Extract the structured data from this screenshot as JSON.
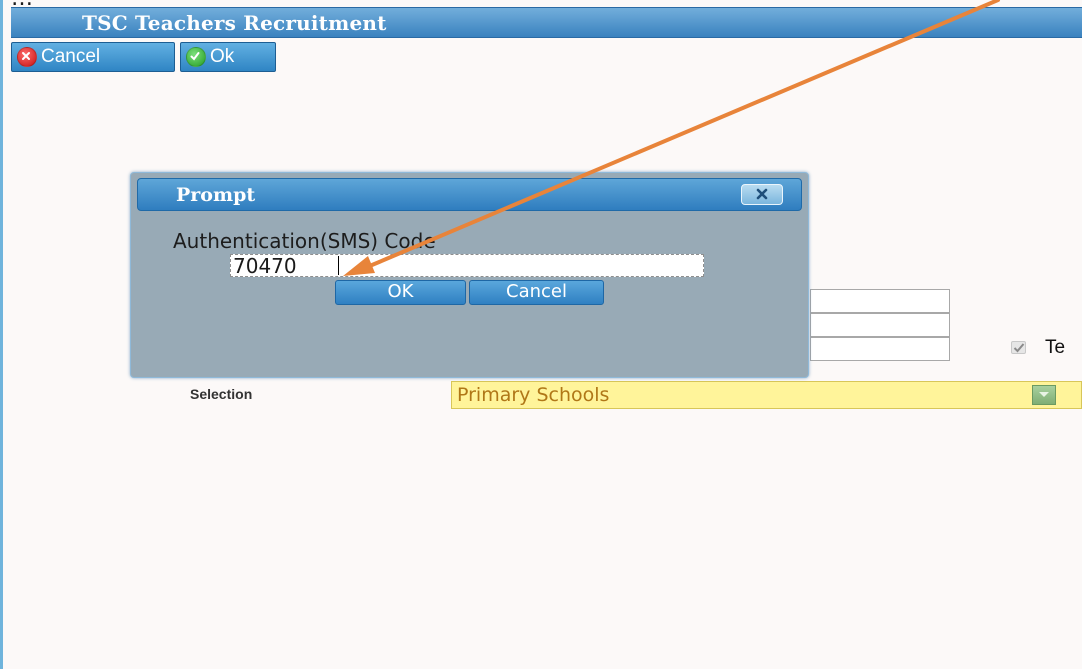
{
  "window": {
    "title": "TSC Teachers Recruitment",
    "top_glyph": "…"
  },
  "toolbar": {
    "cancel_label": "Cancel",
    "ok_label": "Ok"
  },
  "form": {
    "checkbox_label": "Te",
    "checkbox_checked": true,
    "selection_label": "Selection",
    "selection_value": "Primary Schools"
  },
  "dialog": {
    "title": "Prompt",
    "field_label": "Authentication(SMS) Code",
    "field_value": "70470",
    "ok_label": "OK",
    "cancel_label": "Cancel"
  },
  "annotation": {
    "arrow_color": "#e8843a"
  },
  "colors": {
    "header_blue": "#3a82bf",
    "dialog_body": "#98aab6",
    "select_fill": "#fff49a",
    "select_text": "#b07717"
  },
  "icons": {
    "toolbar_cancel": "red-x-circle-icon",
    "toolbar_ok": "green-check-circle-icon",
    "dialog_close": "close-icon",
    "select_dropdown": "chevron-down-icon",
    "checkbox": "checkmark-icon"
  }
}
